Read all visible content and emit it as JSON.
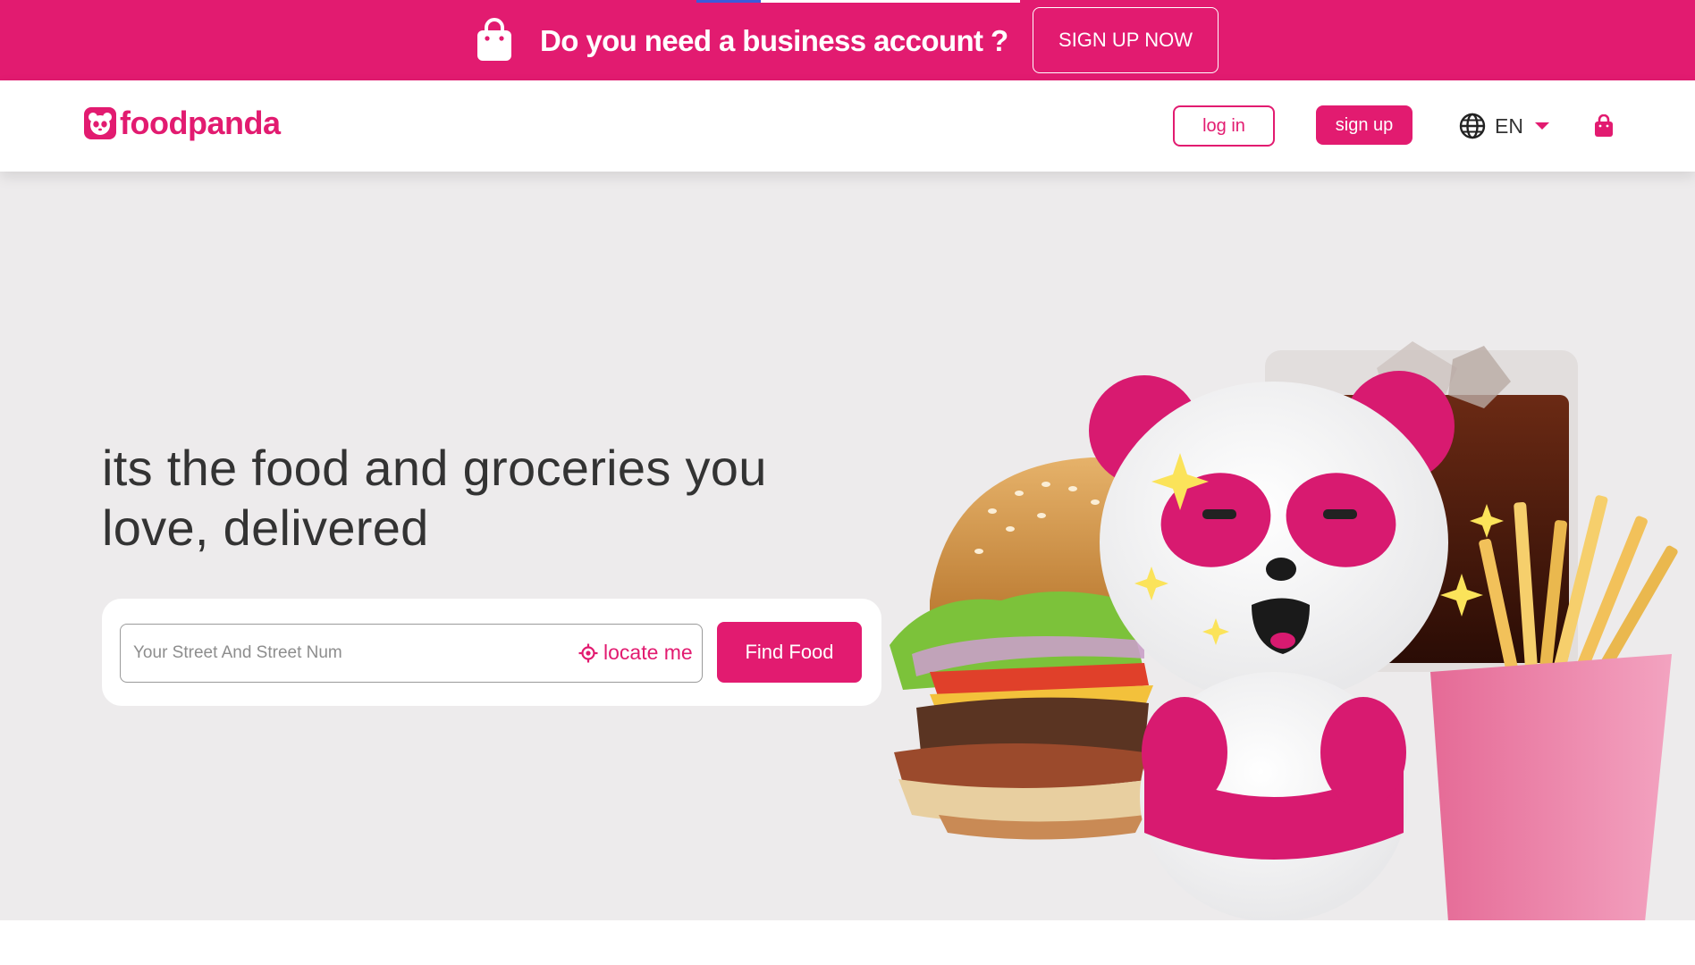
{
  "promo": {
    "text": "Do you need a business account ?",
    "cta_label": "SIGN UP NOW",
    "icon": "shopping-bag-icon",
    "progress": 0.2
  },
  "header": {
    "logo_text": "foodpanda",
    "login_label": "log in",
    "signup_label": "sign up",
    "language": "EN",
    "icons": [
      "panda-logo-icon",
      "globe-icon",
      "chevron-down-icon",
      "cart-icon"
    ]
  },
  "hero": {
    "headline": "its the food and groceries you love, delivered",
    "search": {
      "placeholder": "Your Street And Street Num",
      "value": "",
      "locate_label": "locate me",
      "submit_label": "Find Food"
    },
    "illustration": "panda-with-burger-fries-and-cola"
  },
  "colors": {
    "brand": "#e21b70",
    "hero_bg": "#edebec",
    "text": "#333333",
    "white": "#ffffff"
  }
}
